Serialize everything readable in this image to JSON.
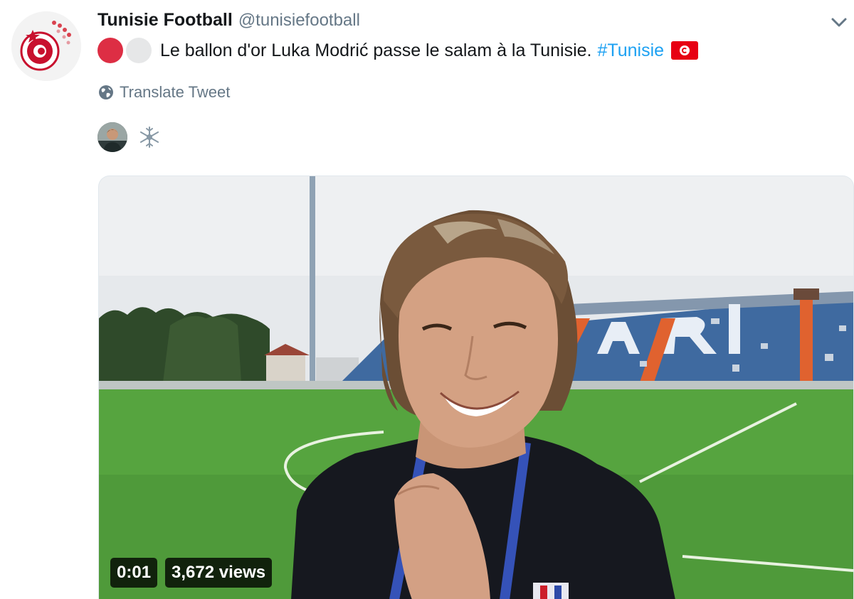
{
  "tweet": {
    "author": {
      "display_name": "Tunisie Football",
      "handle": "@tunisiefootball",
      "avatar": "tunisian-football-federation-crest"
    },
    "text": {
      "emojis": [
        "red-circle",
        "white-circle"
      ],
      "body": "Le ballon d'or Luka Modrić passe le salam à la Tunisie.",
      "hashtag": "#Tunisie",
      "flag": "tunisia-flag"
    },
    "translate_label": "Translate Tweet",
    "tagged": {
      "avatar": "player-avatar",
      "icon": "snowflake-icon"
    },
    "menu_icon": "chevron-down-icon",
    "video": {
      "timestamp": "0:01",
      "views": "3,672 views",
      "scene": "player-smiling-in-stadium"
    }
  },
  "colors": {
    "link": "#1da1f2",
    "secondary_text": "#657786",
    "primary_text": "#14171a",
    "red_circle": "#dd2e44",
    "white_circle": "#e6e7e8",
    "flag_red": "#e70013"
  }
}
